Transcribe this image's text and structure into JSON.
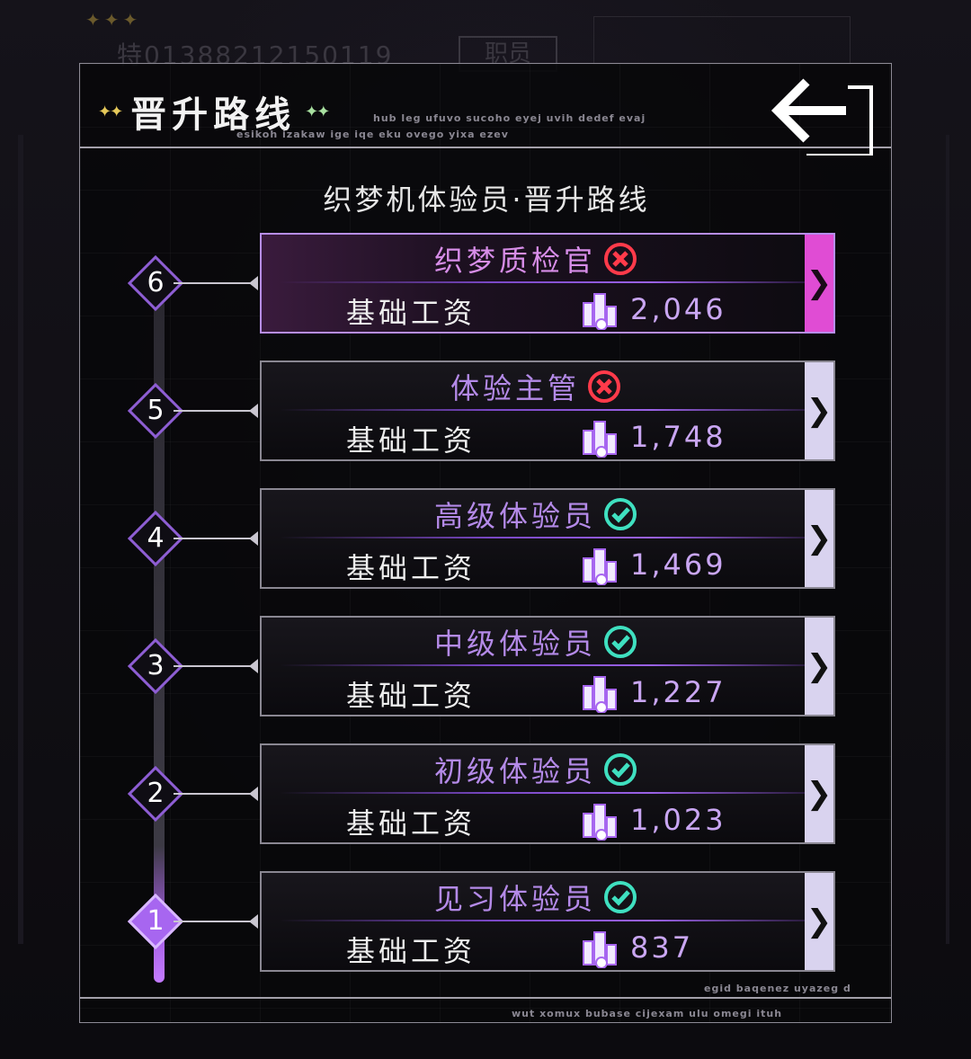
{
  "background": {
    "stars": "✦✦✦",
    "id_text": "特01388212150119",
    "tag": "职员"
  },
  "panel": {
    "title": "晋升路线",
    "deco_top_right": "hub leg ufuvo sucoho eyej uvih dedef evaj",
    "deco_under_title": "esikoh izakaw ige iqe eku ovego yixa ezev",
    "subtitle": "织梦机体验员·晋升路线",
    "deco_bottom_right": "egid baqenez uyazeg d",
    "deco_bottom": "wut xomux bubase cijexam ulu omegi ituh"
  },
  "levels": [
    {
      "num": "6",
      "title": "织梦质检官",
      "status": "locked",
      "salary_label": "基础工资",
      "salary": "2,046"
    },
    {
      "num": "5",
      "title": "体验主管",
      "status": "locked",
      "salary_label": "基础工资",
      "salary": "1,748"
    },
    {
      "num": "4",
      "title": "高级体验员",
      "status": "unlocked",
      "salary_label": "基础工资",
      "salary": "1,469"
    },
    {
      "num": "3",
      "title": "中级体验员",
      "status": "unlocked",
      "salary_label": "基础工资",
      "salary": "1,227"
    },
    {
      "num": "2",
      "title": "初级体验员",
      "status": "unlocked",
      "salary_label": "基础工资",
      "salary": "1,023"
    },
    {
      "num": "1",
      "title": "见习体验员",
      "status": "unlocked",
      "salary_label": "基础工资",
      "salary": "837"
    }
  ],
  "icons": {
    "locked": "x-circle-icon",
    "unlocked": "check-circle-icon",
    "salary": "coin-stack-icon",
    "back": "back-arrow-icon",
    "card_arrow": "chevron-right-icon"
  },
  "colors": {
    "accent_purple": "#a766f0",
    "locked_red": "#ff3a4a",
    "unlocked_teal": "#3fe0c0",
    "top_card_arrow": "#e04cd4"
  },
  "card_arrow_glyph": "❯"
}
